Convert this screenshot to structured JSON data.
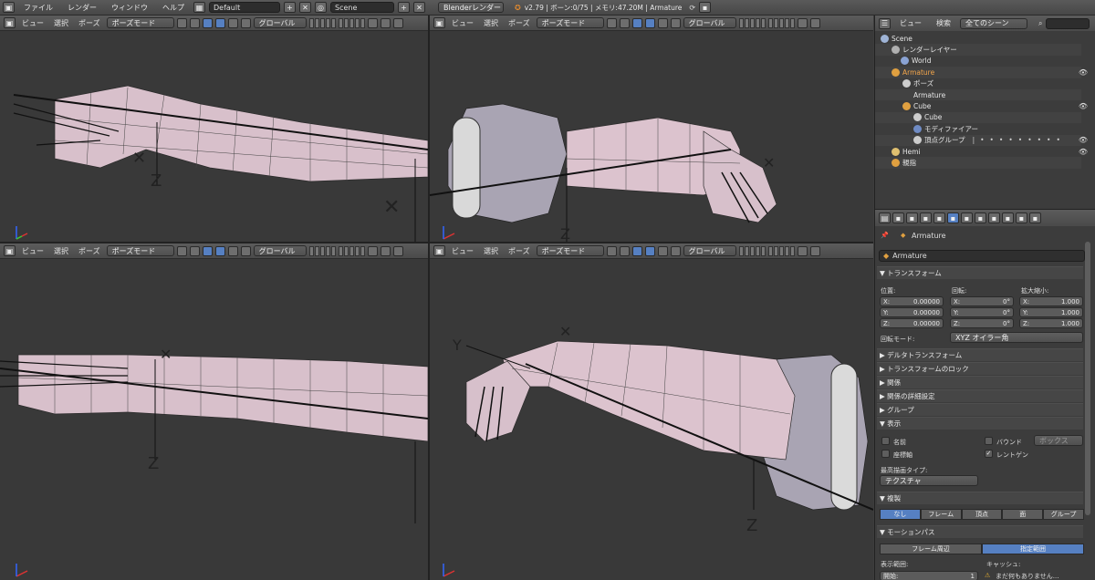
{
  "topbar": {
    "menus": [
      "ファイル",
      "レンダー",
      "ウィンドウ",
      "ヘルプ"
    ],
    "screen": "Default",
    "scene": "Scene",
    "engine": "Blenderレンダー",
    "status": "v2.79 | ボーン:0/75 | メモリ:47.20M | Armature"
  },
  "viewport_header": {
    "menus": [
      "ビュー",
      "選択",
      "ポーズ"
    ],
    "mode": "ポーズモード",
    "orientation": "グローバル"
  },
  "viewports": [
    {
      "axis_label": "Z"
    },
    {
      "axis_label": "Z"
    },
    {
      "axis_label": "Z"
    },
    {
      "axis_label": "Z"
    }
  ],
  "outliner": {
    "header": {
      "view": "ビュー",
      "search": "検索",
      "scene_select": "全てのシーン"
    },
    "items": [
      {
        "label": "Scene",
        "color": "#9fb4d6"
      },
      {
        "label": "レンダーレイヤー",
        "color": "#b0b0b0"
      },
      {
        "label": "World",
        "color": "#8aa3d4"
      },
      {
        "label": "Armature",
        "color": "#e0a040"
      },
      {
        "label": "ポーズ",
        "color": "#cccccc"
      },
      {
        "label": "Armature",
        "color": "#cccccc"
      },
      {
        "label": "Cube",
        "color": "#e0a040"
      },
      {
        "label": "Cube",
        "color": "#cccccc"
      },
      {
        "label": "モディファイアー",
        "color": "#6f8bc4"
      },
      {
        "label": "頂点グループ",
        "color": "#cccccc"
      },
      {
        "label": "Hemi",
        "color": "#e0c070"
      },
      {
        "label": "親指",
        "color": "#e0a040"
      }
    ]
  },
  "properties": {
    "breadcrumb": "Armature",
    "name_field": "Armature",
    "transform": {
      "title": "▼ トランスフォーム",
      "location_label": "位置:",
      "rotation_label": "回転:",
      "scale_label": "拡大縮小:",
      "location": [
        {
          "axis": "X:",
          "value": "0.00000"
        },
        {
          "axis": "Y:",
          "value": "0.00000"
        },
        {
          "axis": "Z:",
          "value": "0.00000"
        }
      ],
      "rotation": [
        {
          "axis": "X:",
          "value": "0°"
        },
        {
          "axis": "Y:",
          "value": "0°"
        },
        {
          "axis": "Z:",
          "value": "0°"
        }
      ],
      "scale": [
        {
          "axis": "X:",
          "value": "1.000"
        },
        {
          "axis": "Y:",
          "value": "1.000"
        },
        {
          "axis": "Z:",
          "value": "1.000"
        }
      ],
      "rotation_mode_label": "回転モード:",
      "rotation_mode": "XYZ オイラー角"
    },
    "collapsed_panels": [
      "▶ デルタトランスフォーム",
      "▶ トランスフォームのロック",
      "▶ 関係",
      "▶ 関係の詳細設定",
      "▶ グループ"
    ],
    "display": {
      "title": "▼ 表示",
      "name": "名前",
      "bounds": "バウンド",
      "bounds_type": "ボックス",
      "axis": "座標軸",
      "xray": "レントゲン",
      "max_draw_label": "最高描画タイプ:",
      "max_draw": "テクスチャ"
    },
    "duplication": {
      "title": "▼ 複製",
      "options": [
        "なし",
        "フレーム",
        "頂点",
        "面",
        "グループ"
      ]
    },
    "motion_paths": {
      "title": "▼ モーションパス",
      "options": [
        "フレーム周辺",
        "指定範囲"
      ],
      "display_range": "表示範囲:",
      "cache": "キャッシュ:",
      "start": "開始:",
      "start_value": "1",
      "warning": "まだ何もありません..."
    }
  }
}
